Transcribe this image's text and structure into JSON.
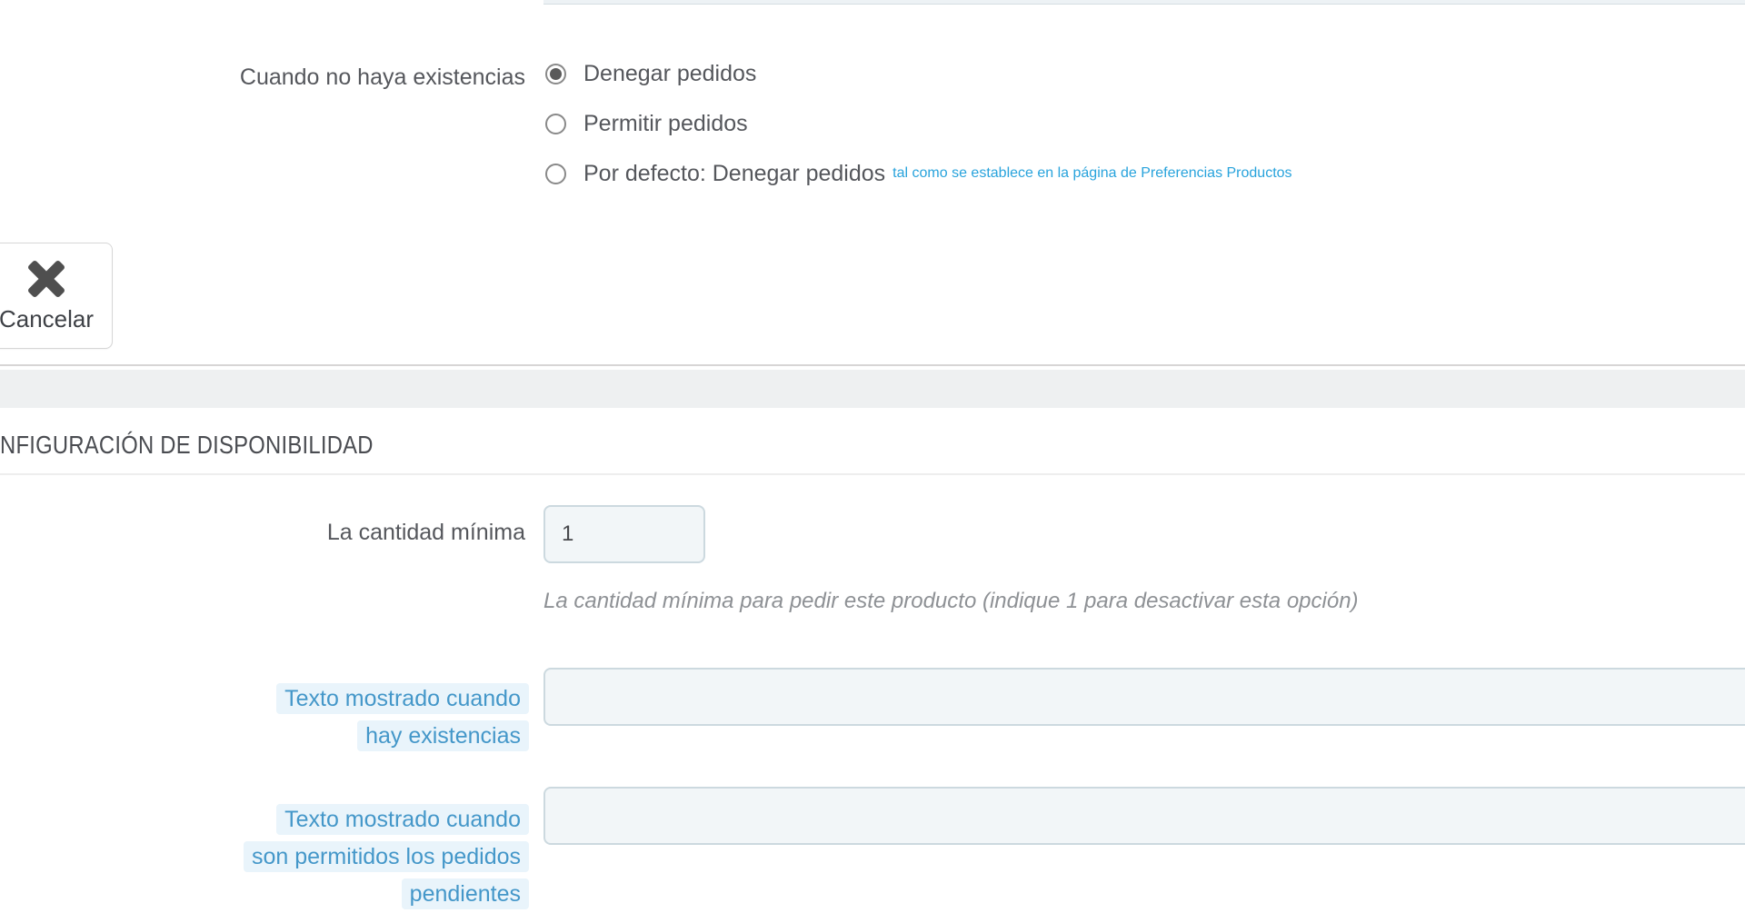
{
  "colors": {
    "link_blue": "#28a3dc",
    "tooltip_label_blue": "#4497c9",
    "tooltip_label_bg": "#e9f4fb",
    "input_bg": "#f2f6f8",
    "input_border": "#ccd9df",
    "panel_gap_gray": "#eef0f1",
    "text_gray": "#55575c"
  },
  "stock_section": {
    "label": "Cuando no haya existencias",
    "options": [
      {
        "label": "Denegar pedidos",
        "selected": true
      },
      {
        "label": "Permitir pedidos",
        "selected": false
      },
      {
        "label": "Por defecto: Denegar pedidos",
        "selected": false,
        "link": "tal como se establece en la página de Preferencias Productos"
      }
    ]
  },
  "toolbar": {
    "cancel_label": "Cancelar"
  },
  "availability_section": {
    "heading": "NFIGURACIÓN DE DISPONIBILIDAD",
    "min_qty": {
      "label": "La cantidad mínima",
      "value": "1",
      "help": "La cantidad mínima para pedir este producto (indique 1 para desactivar esta opción)"
    },
    "in_stock_text": {
      "label_lines": [
        "Texto mostrado cuando",
        "hay existencias"
      ],
      "value": ""
    },
    "backorder_text": {
      "label_lines": [
        "Texto mostrado cuando",
        "son permitidos los pedidos",
        "pendientes"
      ],
      "value": ""
    }
  }
}
